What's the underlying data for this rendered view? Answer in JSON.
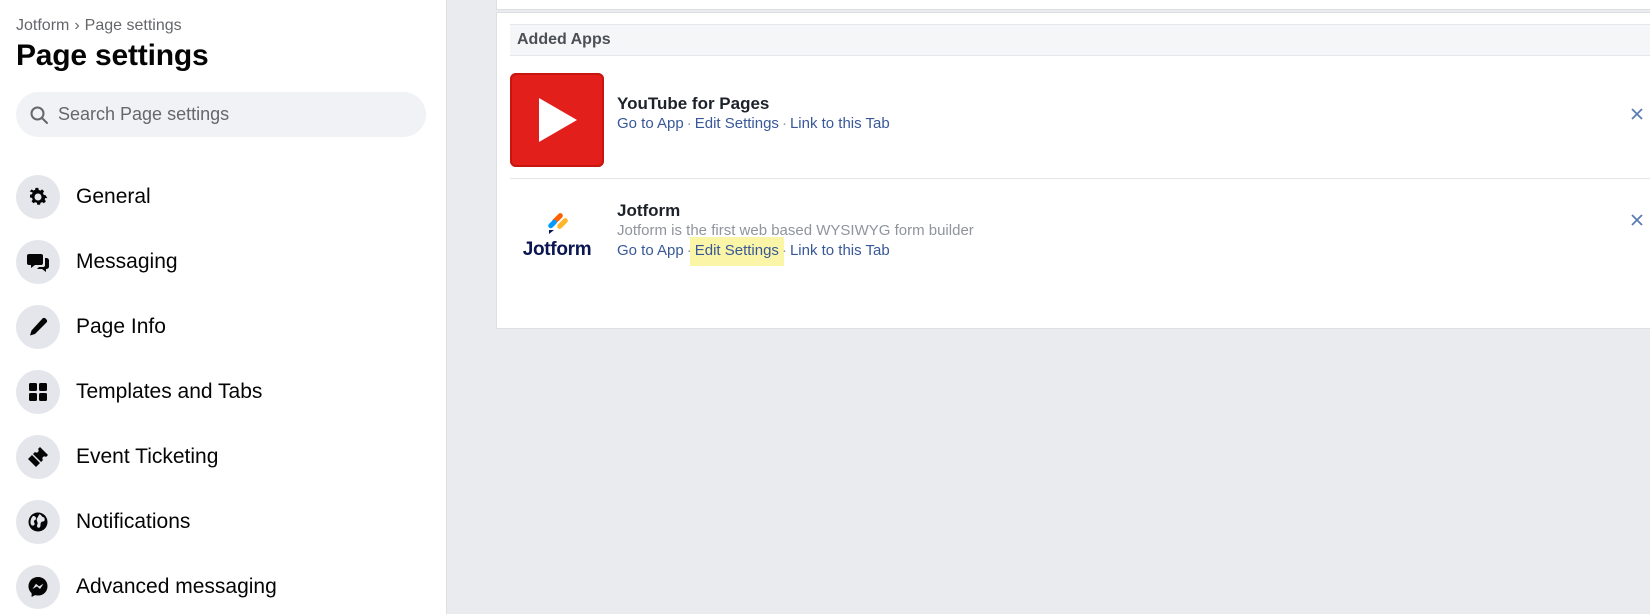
{
  "sidebar": {
    "breadcrumb": {
      "parent": "Jotform",
      "separator": "›",
      "current": "Page settings"
    },
    "title": "Page settings",
    "search": {
      "placeholder": "Search Page settings",
      "value": ""
    },
    "items": [
      {
        "label": "General",
        "icon": "gear-icon"
      },
      {
        "label": "Messaging",
        "icon": "chat-bubbles-icon"
      },
      {
        "label": "Page Info",
        "icon": "pencil-icon"
      },
      {
        "label": "Templates and Tabs",
        "icon": "grid-icon"
      },
      {
        "label": "Event Ticketing",
        "icon": "ticket-icon"
      },
      {
        "label": "Notifications",
        "icon": "globe-icon"
      },
      {
        "label": "Advanced messaging",
        "icon": "messenger-icon"
      }
    ]
  },
  "main": {
    "section_title": "Added Apps",
    "apps": [
      {
        "name": "YouTube for Pages",
        "description": "",
        "links": [
          "Go to App",
          "Edit Settings",
          "Link to this Tab"
        ],
        "icon": "youtube-play-icon"
      },
      {
        "name": "Jotform",
        "description": "Jotform is the first web based WYSIWYG form builder",
        "links": [
          "Go to App",
          "Edit Settings",
          "Link to this Tab"
        ],
        "logo_text": "Jotform",
        "icon": "jotform-logo"
      }
    ]
  },
  "colors": {
    "link": "#385898",
    "highlight": "#fbf5a8",
    "youtube_red": "#e21f1a",
    "background": "#e9ebee"
  }
}
